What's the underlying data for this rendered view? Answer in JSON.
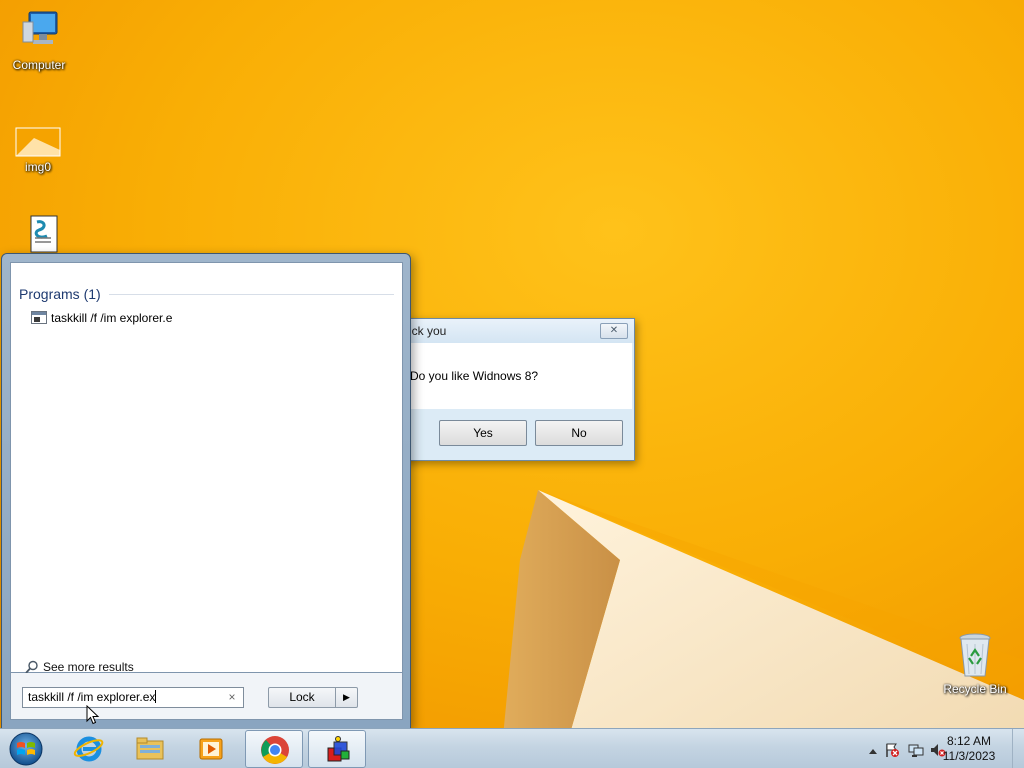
{
  "desktop": {
    "icons": [
      {
        "label": "Computer",
        "icon": "computer-icon"
      },
      {
        "label": "img0",
        "icon": "folder-icon"
      },
      {
        "label": "Recycle Bin",
        "icon": "recycle-bin-icon"
      }
    ]
  },
  "dialog": {
    "title": "uck you",
    "close_symbol": "✕",
    "message": "Do you like Widnows 8?",
    "yes_label": "Yes",
    "no_label": "No"
  },
  "start_menu": {
    "group_header": "Programs (1)",
    "results": [
      {
        "label": "taskkill /f /im explorer.e",
        "icon": "program-window-icon"
      }
    ],
    "see_more": "See more results",
    "search": {
      "value": "taskkill /f /im explorer.ex",
      "clear_symbol": "×"
    },
    "power_button_label": "Lock",
    "power_arrow_symbol": "▶"
  },
  "taskbar": {
    "pinned": [
      {
        "name": "internet-explorer",
        "icon": "ie-icon"
      },
      {
        "name": "file-explorer",
        "icon": "folder-icon"
      },
      {
        "name": "media-player",
        "icon": "media-player-icon"
      },
      {
        "name": "chrome",
        "icon": "chrome-icon",
        "active": true
      },
      {
        "name": "app-cube",
        "icon": "cube-app-icon",
        "active": true
      }
    ],
    "tray": {
      "time": "8:12 AM",
      "date": "11/3/2023",
      "icons": [
        "show-hidden-icon",
        "action-center-flag-icon",
        "network-icon",
        "volume-muted-icon"
      ]
    }
  },
  "colors": {
    "wallpaper_orange": "#f6a100",
    "wallpaper_light": "#ffc21a",
    "start_menu_frame": "#9fb5cb",
    "taskbar": "#c4d4e2"
  }
}
